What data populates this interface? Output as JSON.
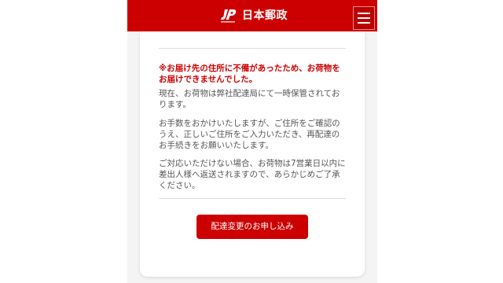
{
  "header": {
    "brand_name": "日本郵政",
    "logo_icon": "jp-post-logo-icon",
    "menu_icon": "hamburger-menu-icon",
    "colors": {
      "header_bg": "#cc0000",
      "brand_text": "#ffffff"
    }
  },
  "notice": {
    "alert": "※お届け先の住所に不備があったため、お荷物をお届けできませんでした。",
    "paragraphs": [
      "現在、お荷物は弊社配達局にて一時保管されております。",
      "お手数をおかけいたしますが、ご住所をご確認のうえ、正しいご住所をご入力いただき、再配達のお手続きをお願いいたします。",
      "ご対応いただけない場合、お荷物は7営業日以内に差出人様へ返送されますので、あらかじめご了承ください。"
    ],
    "colors": {
      "alert_text": "#cc0000",
      "body_text": "#555555"
    }
  },
  "cta": {
    "label": "配達変更のお申し込み",
    "color": "#cc0000"
  }
}
